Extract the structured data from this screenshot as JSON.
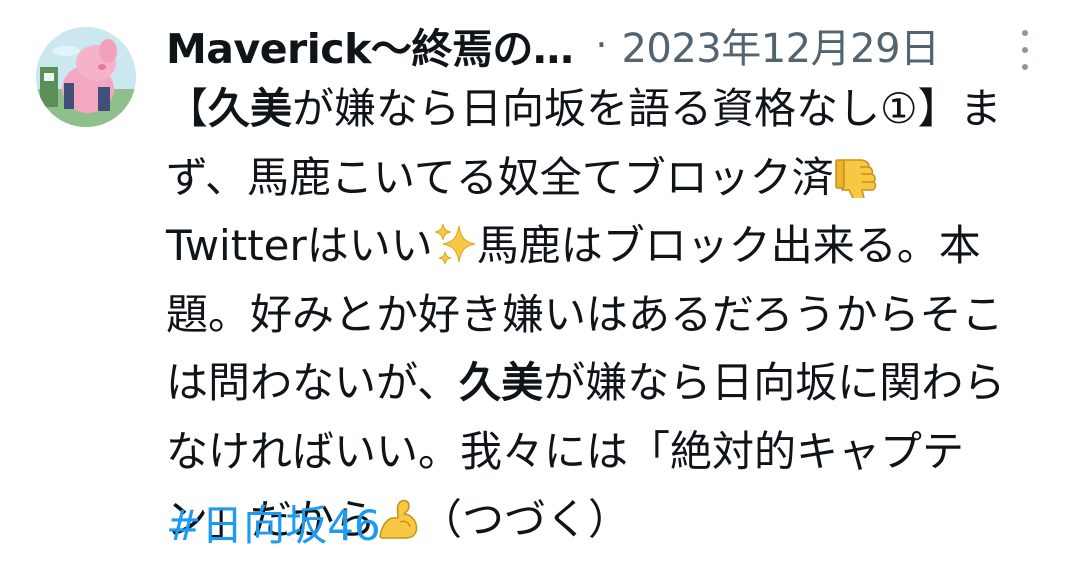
{
  "tweet": {
    "author_name": "Maverick〜終焉の…",
    "separator": "·",
    "date": "2023年12月29日",
    "lines": [
      {
        "parts": [
          {
            "t": "【"
          },
          {
            "t": "久美",
            "bold": true
          },
          {
            "t": "が嫌なら日向坂を語る資格なし①】ま"
          }
        ]
      },
      {
        "parts": [
          {
            "t": "ず、馬鹿こいてる奴全てブロック済"
          },
          {
            "emoji": "thumbs-down"
          }
        ]
      },
      {
        "parts": [
          {
            "t": "Twitterはいい"
          },
          {
            "emoji": "sparkles"
          },
          {
            "t": "馬鹿はブロック出来る。本"
          }
        ]
      },
      {
        "parts": [
          {
            "t": "題。好みとか好き嫌いはあるだろうからそこ"
          }
        ]
      },
      {
        "parts": [
          {
            "t": "は問わないが、"
          },
          {
            "t": "久美",
            "bold": true
          },
          {
            "t": "が嫌なら日向坂に関わら"
          }
        ]
      },
      {
        "parts": [
          {
            "t": "なければいい。我々には「絶対的キャプテ"
          }
        ]
      },
      {
        "parts": [
          {
            "t": "ン」だから"
          },
          {
            "emoji": "flexed-biceps"
          },
          {
            "t": "（つづく）"
          }
        ]
      }
    ],
    "hashtag": "#日向坂46"
  },
  "icons": {
    "avatar": "avatar-image",
    "more": "more-options-icon",
    "emoji_thumbs_down": "thumbs-down-emoji",
    "emoji_sparkles": "sparkles-emoji",
    "emoji_flexed_biceps": "flexed-biceps-emoji"
  },
  "colors": {
    "text": "#0f1419",
    "secondary": "#536471",
    "link": "#1d9bf0",
    "emoji_yellow": "#f7c844"
  }
}
